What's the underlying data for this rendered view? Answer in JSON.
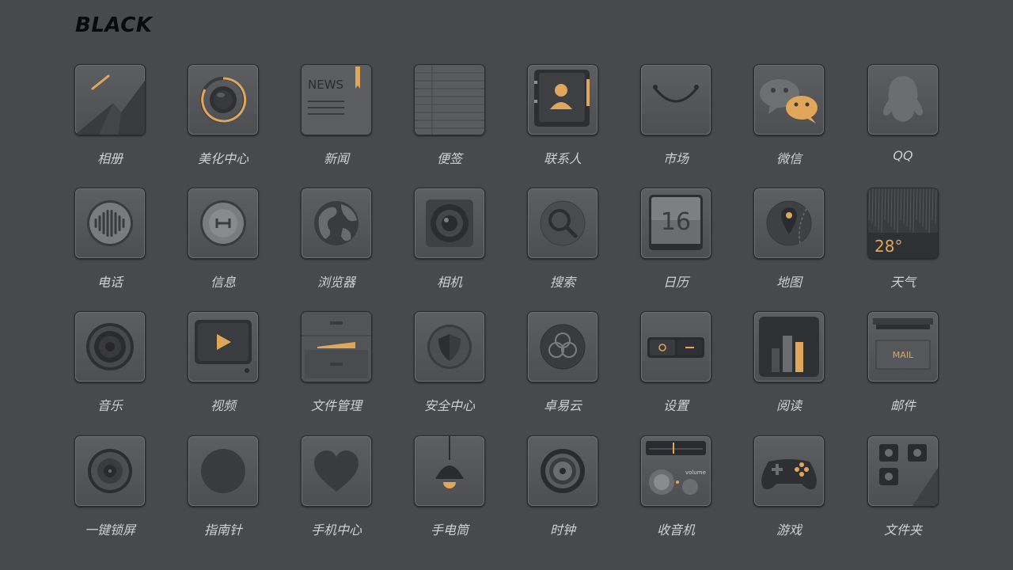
{
  "title": "BLACK",
  "colors": {
    "background": "#48494d",
    "accent": "#e0a659",
    "icon_face": "#55565a",
    "label": "#cfd0d3"
  },
  "icons": [
    {
      "label": "相册",
      "icon": "album-icon"
    },
    {
      "label": "美化中心",
      "icon": "theme-center-icon"
    },
    {
      "label": "新闻",
      "icon": "news-icon",
      "glyph_text": "NEWS"
    },
    {
      "label": "便签",
      "icon": "notes-icon"
    },
    {
      "label": "联系人",
      "icon": "contacts-icon"
    },
    {
      "label": "市场",
      "icon": "market-icon"
    },
    {
      "label": "微信",
      "icon": "wechat-icon"
    },
    {
      "label": "QQ",
      "icon": "qq-icon"
    },
    {
      "label": "电话",
      "icon": "phone-icon"
    },
    {
      "label": "信息",
      "icon": "messages-icon"
    },
    {
      "label": "浏览器",
      "icon": "browser-globe-icon"
    },
    {
      "label": "相机",
      "icon": "camera-icon"
    },
    {
      "label": "搜索",
      "icon": "search-icon"
    },
    {
      "label": "日历",
      "icon": "calendar-icon",
      "glyph_text": "16"
    },
    {
      "label": "地图",
      "icon": "map-pin-icon"
    },
    {
      "label": "天气",
      "icon": "weather-icon",
      "glyph_text": "28°"
    },
    {
      "label": "音乐",
      "icon": "music-speaker-icon"
    },
    {
      "label": "视频",
      "icon": "video-play-icon"
    },
    {
      "label": "文件管理",
      "icon": "file-drawer-icon"
    },
    {
      "label": "安全中心",
      "icon": "security-shield-icon"
    },
    {
      "label": "卓易云",
      "icon": "cloud-icon"
    },
    {
      "label": "设置",
      "icon": "settings-toggle-icon"
    },
    {
      "label": "阅读",
      "icon": "reading-books-icon"
    },
    {
      "label": "邮件",
      "icon": "mail-icon",
      "glyph_text": "MAIL"
    },
    {
      "label": "一键锁屏",
      "icon": "lock-screen-icon"
    },
    {
      "label": "指南针",
      "icon": "compass-icon"
    },
    {
      "label": "手机中心",
      "icon": "phone-center-heart-icon"
    },
    {
      "label": "手电筒",
      "icon": "flashlight-lamp-icon"
    },
    {
      "label": "时钟",
      "icon": "clock-icon"
    },
    {
      "label": "收音机",
      "icon": "radio-icon",
      "glyph_text": "volume"
    },
    {
      "label": "游戏",
      "icon": "gamepad-icon"
    },
    {
      "label": "文件夹",
      "icon": "folder-icon"
    }
  ]
}
